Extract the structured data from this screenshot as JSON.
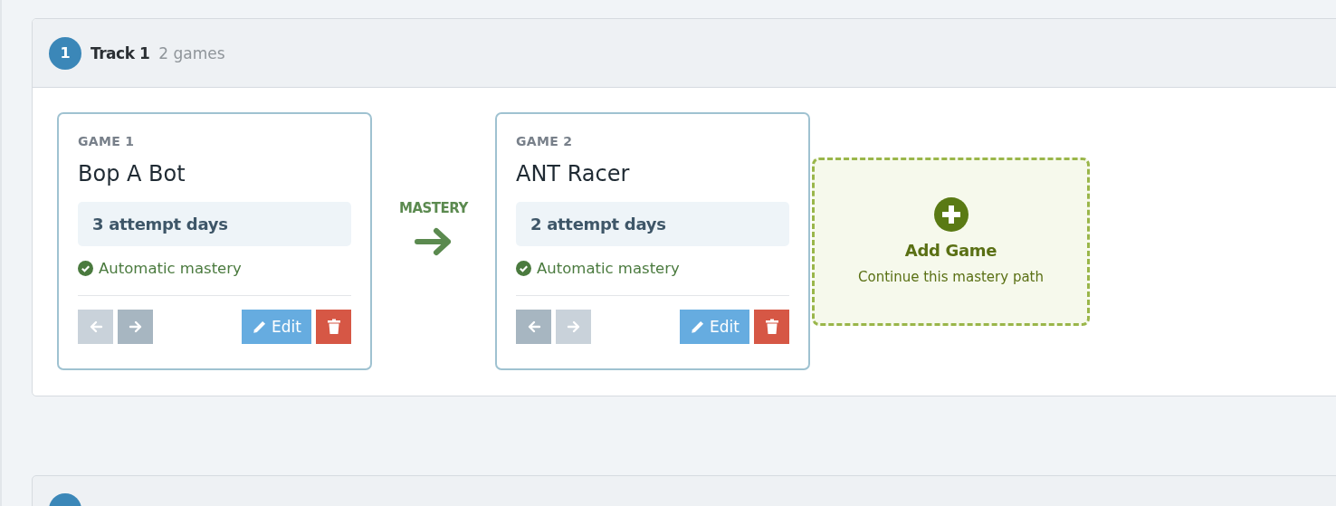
{
  "track": {
    "number": "1",
    "title": "Track 1",
    "count": "2 games"
  },
  "games": [
    {
      "label": "GAME 1",
      "name": "Bop A Bot",
      "attempts": "3 attempt days",
      "mastery": "Automatic mastery",
      "left_disabled": true,
      "right_disabled": false,
      "edit": "Edit"
    },
    {
      "label": "GAME 2",
      "name": "ANT Racer",
      "attempts": "2 attempt days",
      "mastery": "Automatic mastery",
      "left_disabled": false,
      "right_disabled": true,
      "edit": "Edit"
    }
  ],
  "connector": {
    "label": "MASTERY"
  },
  "add_game": {
    "title": "Add Game",
    "subtitle": "Continue this mastery path"
  }
}
